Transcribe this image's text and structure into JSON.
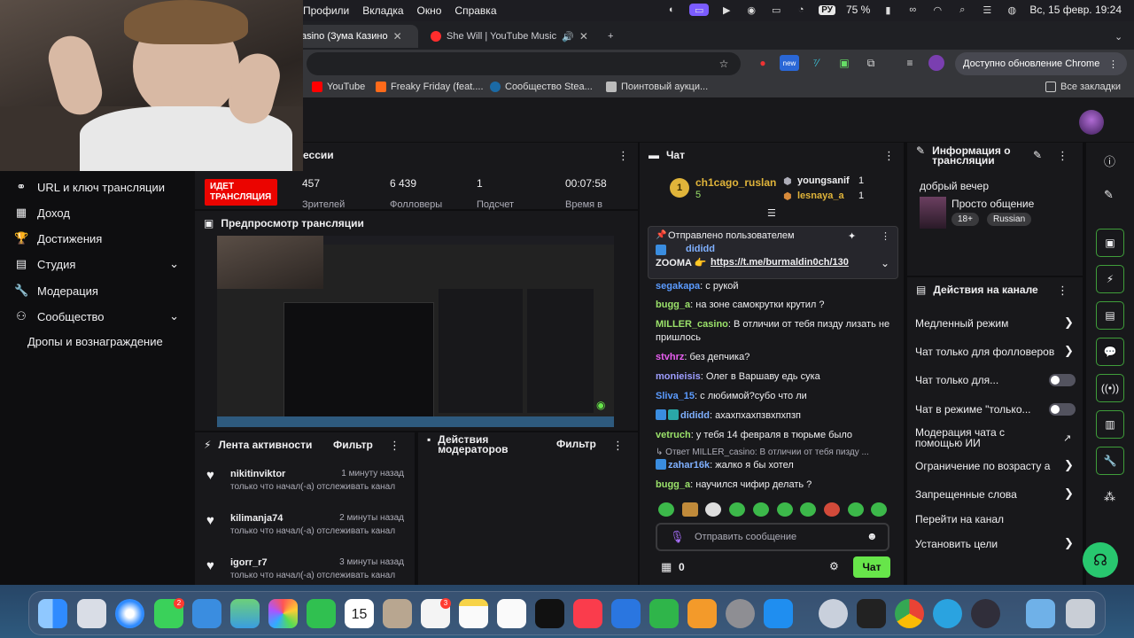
{
  "menubar": {
    "menu_items": [
      "Профили",
      "Вкладка",
      "Окно",
      "Справка"
    ],
    "input_lang": "РУ",
    "battery": "75 %",
    "datetime": "Вс, 15 февр.  19:24"
  },
  "tabs": [
    {
      "title": "asino (Зума Казино",
      "active": true
    },
    {
      "title": "She Will | YouTube Music",
      "active": false
    }
  ],
  "toolbar": {
    "update_label": "Доступно обновление Chrome",
    "ext_badge": "new"
  },
  "bookmarks": {
    "items": [
      "YouTube",
      "Freaky Friday (feat....",
      "Сообщество Stea...",
      "Поинтовый аукци..."
    ],
    "all_label": "Все закладки"
  },
  "sidebar": {
    "items": [
      {
        "label": "URL и ключ трансляции",
        "icon": "link-icon",
        "expand": false
      },
      {
        "label": "Доход",
        "icon": "revenue-icon",
        "expand": false
      },
      {
        "label": "Достижения",
        "icon": "trophy-icon",
        "expand": false
      },
      {
        "label": "Студия",
        "icon": "studio-icon",
        "expand": true
      },
      {
        "label": "Модерация",
        "icon": "wrench-icon",
        "expand": false
      },
      {
        "label": "Сообщество",
        "icon": "community-icon",
        "expand": true
      }
    ],
    "drops_label": "Дропы и вознаграждение"
  },
  "session": {
    "title": "ессии",
    "live_label": "ИДЕТ ТРАНСЛЯЦИЯ",
    "stats": [
      {
        "value": "457",
        "label": "Зрителей"
      },
      {
        "value": "6 439",
        "label": "Фолловеры"
      },
      {
        "value": "1",
        "label": "Подсчет"
      },
      {
        "value": "00:07:58",
        "label": "Время в"
      }
    ]
  },
  "preview": {
    "title": "Предпросмотр трансляции"
  },
  "activity": {
    "title": "Лента активности",
    "filter_label": "Фильтр",
    "events": [
      {
        "user": "nikitinviktor",
        "time": "1 минуту назад",
        "desc": "только что начал(-а) отслеживать канал"
      },
      {
        "user": "kilimanja74",
        "time": "2 минуты назад",
        "desc": "только что начал(-а) отслеживать канал"
      },
      {
        "user": "igorr_r7",
        "time": "3 минуты назад",
        "desc": "только что начал(-а) отслеживать канал"
      }
    ]
  },
  "mod_actions": {
    "title": "Действия модераторов",
    "filter_label": "Фильтр"
  },
  "chat": {
    "title": "Чат",
    "leaderboard": [
      {
        "rank": "1",
        "user": "ch1cago_ruslan",
        "amount": "5"
      },
      {
        "user": "youngsanif",
        "amount": "1"
      },
      {
        "user": "lesnaya_a",
        "amount": "1"
      }
    ],
    "pinned": {
      "header": "Отправлено пользователем",
      "user": "dididd",
      "text": "ZOOMA 👉 ",
      "link": "https://t.me/burmaldin0ch/130"
    },
    "messages": [
      {
        "user": "segakapa",
        "text": "с рукой",
        "color": "#5b9bff"
      },
      {
        "user": "bugg_a",
        "text": "на зоне самокрутки крутил ?",
        "color": "#9be26a"
      },
      {
        "user": "MILLER_casino",
        "text": "В отличии от тебя пизду лизать не пришлось",
        "color": "#9be26a"
      },
      {
        "user": "stvhrz",
        "text": "без депчика?",
        "color": "#e85ef0"
      },
      {
        "user": "monieisis",
        "text": "Олег в Варшаву едь сука",
        "color": "#9e9eff"
      },
      {
        "user": "Sliva_15",
        "text": "с любимой?субо что ли",
        "color": "#5b9bff"
      },
      {
        "user": "dididd",
        "text": "ахахпхахпзвхпхпзп",
        "color": "#7fb0ff"
      },
      {
        "user": "vetruch",
        "text": "у тебя 14 февраля в тюрьме было",
        "color": "#9be26a"
      },
      {
        "user": "zahar16k",
        "text": "жалко я бы хотел",
        "color": "#7fb0ff"
      },
      {
        "user": "bugg_a",
        "text": "научился чифир делать ?",
        "color": "#9be26a"
      }
    ],
    "reply_to": "Ответ MILLER_casino: В отличии от тебя пизду ...",
    "input_placeholder": "Отправить сообщение",
    "points": "0",
    "send_label": "Чат"
  },
  "stream_info": {
    "title": "Информация о трансляции",
    "stream_title": "добрый вечер",
    "category": "Просто общение",
    "tags": [
      "18+",
      "Russian"
    ]
  },
  "channel_actions": {
    "title": "Действия на канале",
    "items": [
      {
        "label": "Медленный режим",
        "kind": "chevron"
      },
      {
        "label": "Чат только для фолловеров",
        "kind": "chevron"
      },
      {
        "label": "Чат только для...",
        "kind": "toggle"
      },
      {
        "label": "Чат в режиме \"только...",
        "kind": "toggle"
      },
      {
        "label": "Модерация чата с помощью ИИ",
        "kind": "external"
      },
      {
        "label": "Ограничение по возрасту а",
        "kind": "chevron"
      },
      {
        "label": "Запрещенные слова",
        "kind": "chevron"
      },
      {
        "label": "Перейти на канал",
        "kind": "none"
      },
      {
        "label": "Установить цели",
        "kind": "chevron"
      }
    ]
  },
  "dock": {
    "calendar_day": "15",
    "badges": [
      "2",
      "3"
    ],
    "apps": [
      "finder",
      "launchpad",
      "safari",
      "messages",
      "mail",
      "maps",
      "photos",
      "facetime",
      "calendar",
      "contacts",
      "reminders",
      "notes",
      "freeform",
      "tv",
      "music",
      "keynote",
      "numbers",
      "pages",
      "settings",
      "appstore",
      "robot",
      "piano",
      "chrome",
      "telegram",
      "obs",
      "folder",
      "trash"
    ]
  }
}
